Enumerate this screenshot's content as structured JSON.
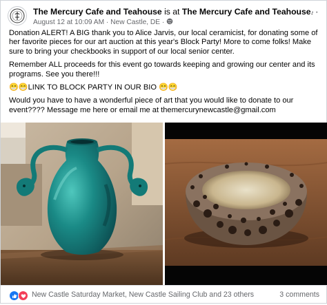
{
  "post": {
    "page_name": "The Mercury Cafe and Teahouse",
    "action": "is at",
    "location": "The Mercury Cafe and Teahouse",
    "location_suffix": ".",
    "timestamp": "August 12 at 10:09 AM",
    "separator": "·",
    "city": "New Castle, DE",
    "separator2": "·",
    "privacy_icon": "globe-icon",
    "more_icon": "more-options-icon",
    "paragraphs": [
      "Donation ALERT!   A BIG thank you to Alice Jarvis, our local ceramicist, for donating some of her favorite pieces for our art auction at this year's Block Party!   More to come folks!  Make sure to bring your checkbooks in support of our local senior center.",
      "Remember ALL proceeds for this event go towards keeping and growing our center and its programs.   See you there!!!",
      "😁😁LINK TO BLOCK PARTY IN OUR BIO 😁😁",
      "Would you have to have a wonderful piece of art that you would like to donate to our event???? Message me here or email me at themercurynewcastle@gmail.com"
    ]
  },
  "photos": [
    {
      "subject": "teal ceramic vase with ram-head handles"
    },
    {
      "subject": "textured ceramic bowl"
    }
  ],
  "footer": {
    "reaction_icons": [
      "like-icon",
      "love-icon"
    ],
    "reactors": "New Castle Saturday Market, New Castle Sailing Club and 23 others",
    "comments": "3 comments"
  },
  "colors": {
    "text": "#050505",
    "secondary": "#65676b",
    "like": "#1877f2",
    "love": "#f33e58",
    "vase": "#1a8a86"
  }
}
